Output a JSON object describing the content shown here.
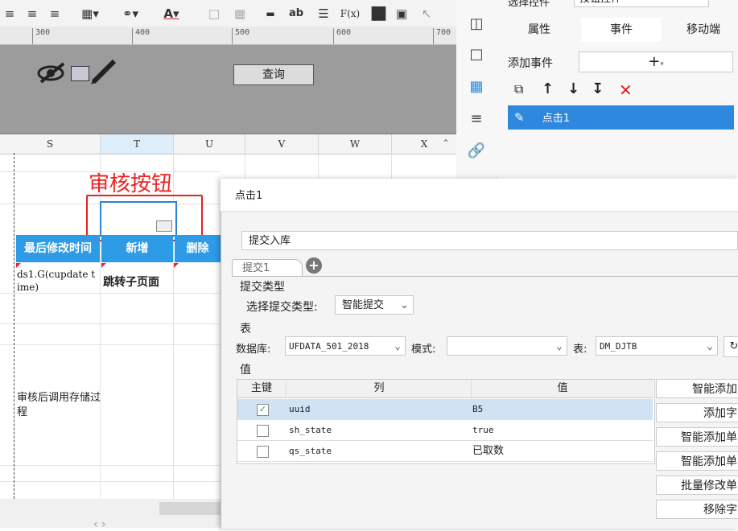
{
  "toolbar": {
    "icons": [
      "align-left-icon",
      "align-center-icon",
      "align-right-icon",
      "border-icon",
      "fill-color-icon",
      "font-color-icon",
      "image-frame-icon",
      "table-icon",
      "button-widget-icon",
      "text-field-icon",
      "list-icon",
      "formula-icon",
      "bar-chart-icon",
      "picture-icon",
      "pointer-icon"
    ],
    "font_color_glyph": "A",
    "text_glyph": "ab",
    "formula_glyph": "F(x)"
  },
  "ruler": {
    "ticks": [
      "300",
      "400",
      "500",
      "600",
      "700"
    ]
  },
  "form_area": {
    "query_button": "查询"
  },
  "sheet": {
    "columns": [
      "S",
      "T",
      "U",
      "V",
      "W",
      "X"
    ],
    "header_row": {
      "last_modified": "最后修改时间",
      "add": "新增",
      "delete": "删除"
    },
    "ds_formula": "ds1.G(cupdate time)",
    "jump_subpage": "跳转子页面",
    "audit_proc_note": "审核后调用存储过程",
    "annotation_label": "审核按钮"
  },
  "right_panel": {
    "top_label": "选择控件",
    "top_value": "按钮控件",
    "tabs": [
      "属性",
      "事件",
      "移动端"
    ],
    "active_tab": "事件",
    "add_event_label": "添加事件",
    "add_symbol": "+",
    "event_item": "点击1"
  },
  "dialog": {
    "title": "点击1",
    "action_type": "提交入库",
    "sub_tab": "提交1",
    "submit_type_section": "提交类型",
    "choose_type_label": "选择提交类型:",
    "choose_type_value": "智能提交",
    "table_section": "表",
    "db_label": "数据库:",
    "db_value": "UFDATA_501_2018",
    "mode_label": "模式:",
    "mode_value": "",
    "table_label": "表:",
    "table_value": "DM_DJTB",
    "value_section": "值",
    "columns": {
      "key": "主键",
      "col": "列",
      "val": "值"
    },
    "rows": [
      {
        "key": true,
        "col": "uuid",
        "val": "B5"
      },
      {
        "key": false,
        "col": "sh_state",
        "val": "true"
      },
      {
        "key": false,
        "col": "qs_state",
        "val": "已取数"
      }
    ],
    "side_buttons": [
      "智能添加",
      "添加字",
      "智能添加单",
      "智能添加单",
      "批量修改单",
      "移除字"
    ]
  },
  "colors": {
    "accent_blue": "#2e88de",
    "red_annotation": "#e32323",
    "header_blue": "#2e9be6"
  }
}
